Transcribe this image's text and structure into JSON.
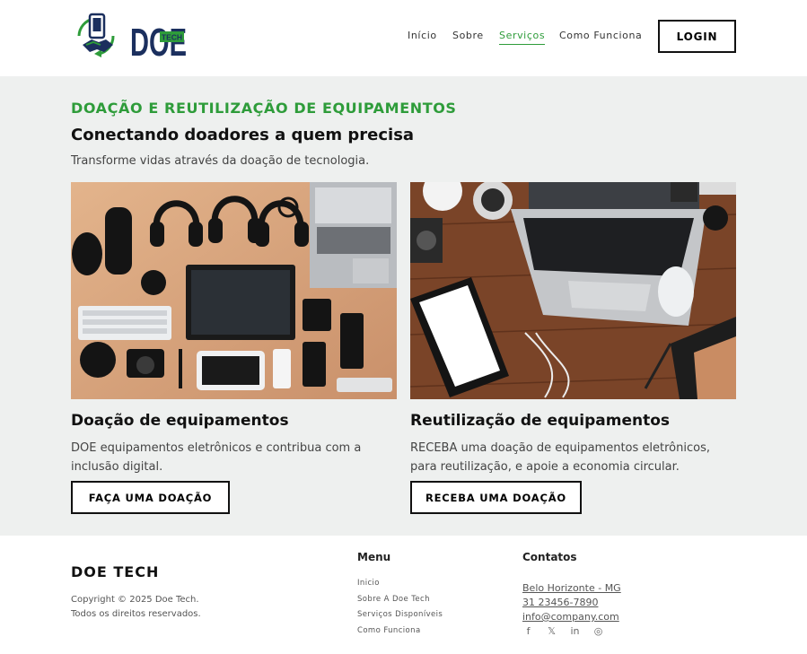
{
  "header": {
    "logo": {
      "text": "DOE",
      "badge": "TECH"
    },
    "nav": [
      {
        "label": "Início",
        "active": false
      },
      {
        "label": "Sobre",
        "active": false
      },
      {
        "label": "Serviços",
        "active": true
      },
      {
        "label": "Como Funciona",
        "active": false
      }
    ],
    "login_label": "LOGIN"
  },
  "hero": {
    "eyebrow": "DOAÇÃO E REUTILIZAÇÃO DE EQUIPAMENTOS",
    "title": "Conectando doadores a quem precisa",
    "subtitle": "Transforme vidas através da doação de tecnologia."
  },
  "cards": [
    {
      "title": "Doação de equipamentos",
      "description": "DOE equipamentos eletrônicos e contribua com a inclusão digital.",
      "button": "FAÇA UMA DOAÇÃO"
    },
    {
      "title": "Reutilização de equipamentos",
      "description": "RECEBA uma doação de equipamentos eletrônicos, para reutilização, e apoie a economia circular.",
      "button": "RECEBA UMA DOAÇÃO"
    }
  ],
  "footer": {
    "brand": "DOE TECH",
    "copyright_line1": "Copyright © 2025 Doe Tech.",
    "copyright_line2": "Todos os direitos reservados.",
    "menu_title": "Menu",
    "menu": [
      "Inicio",
      "Sobre A Doe Tech",
      "Serviços Disponíveis",
      "Como Funciona"
    ],
    "contacts_title": "Contatos",
    "contacts": [
      "Belo Horizonte - MG",
      "31 23456-7890",
      "info@company.com"
    ],
    "socials": [
      {
        "icon": "facebook-icon",
        "glyph": "f"
      },
      {
        "icon": "x-icon",
        "glyph": "𝕏"
      },
      {
        "icon": "linkedin-icon",
        "glyph": "in"
      },
      {
        "icon": "instagram-icon",
        "glyph": "◎"
      }
    ]
  },
  "colors": {
    "accent": "#2e9c3a",
    "navy": "#1b2f5e",
    "background": "#eef0ef"
  }
}
